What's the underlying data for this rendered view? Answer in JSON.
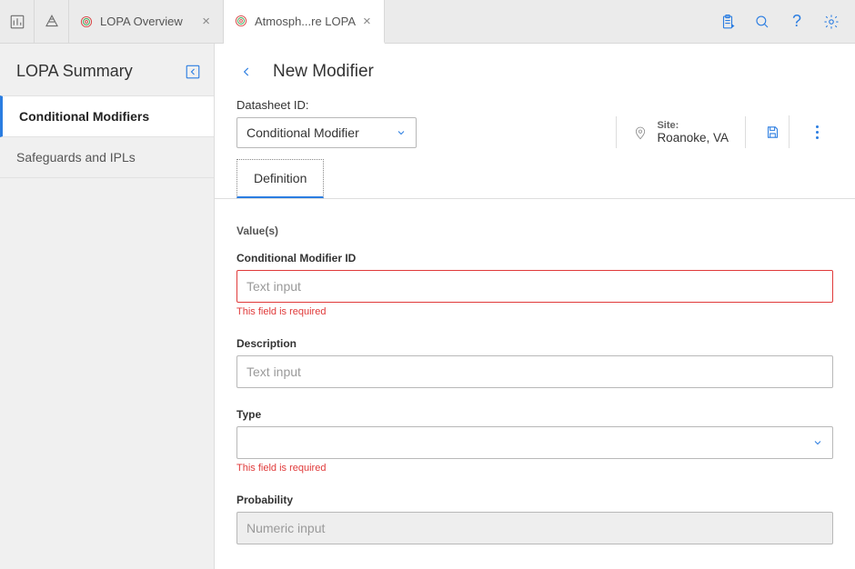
{
  "tabs": [
    {
      "label": "LOPA Overview"
    },
    {
      "label": "Atmosph...re LOPA"
    }
  ],
  "sidebar": {
    "title": "LOPA Summary",
    "items": [
      {
        "label": "Conditional Modifiers"
      },
      {
        "label": "Safeguards and IPLs"
      }
    ]
  },
  "page": {
    "title": "New Modifier",
    "datasheet_label": "Datasheet ID:",
    "datasheet_value": "Conditional Modifier",
    "site_label": "Site:",
    "site_value": "Roanoke, VA",
    "tabs": [
      {
        "label": "Definition"
      }
    ]
  },
  "form": {
    "section": "Value(s)",
    "fields": {
      "cmid": {
        "label": "Conditional Modifier ID",
        "placeholder": "Text input",
        "error": "This field is required"
      },
      "description": {
        "label": "Description",
        "placeholder": "Text input"
      },
      "type": {
        "label": "Type",
        "error": "This field is required"
      },
      "probability": {
        "label": "Probability",
        "placeholder": "Numeric input"
      }
    }
  }
}
